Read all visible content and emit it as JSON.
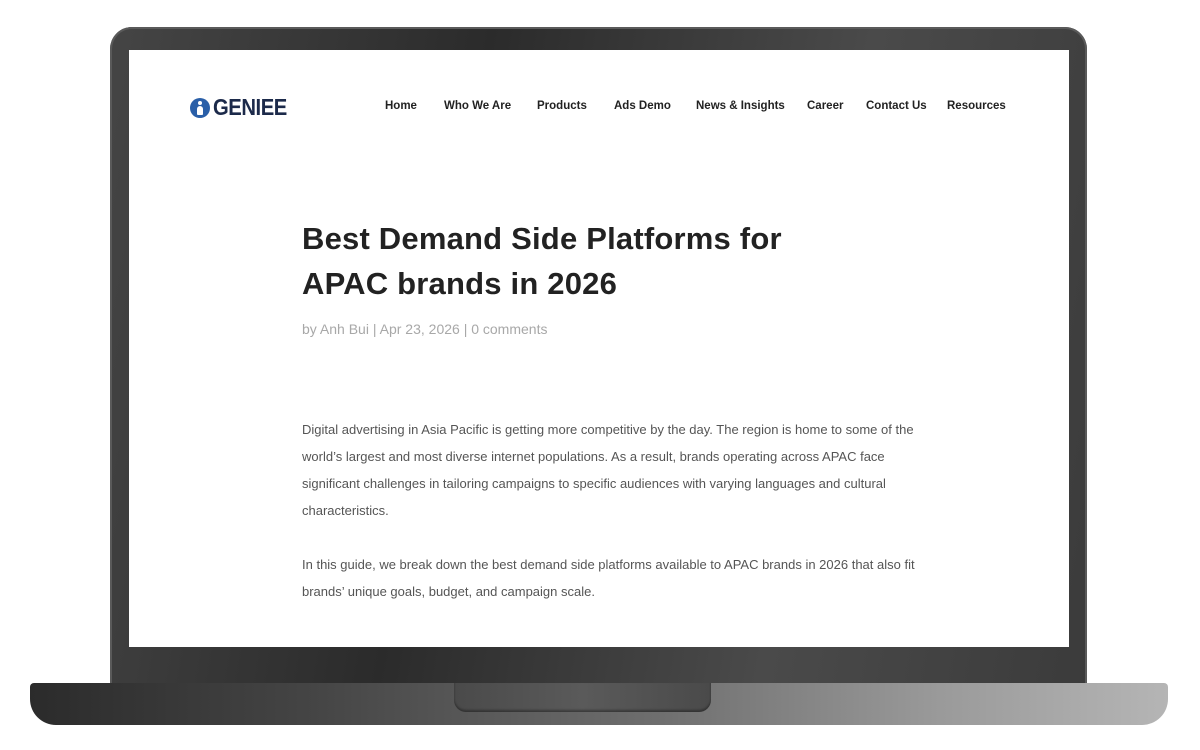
{
  "header": {
    "logo_text": "GENIEE",
    "brand_color": "#2a5fa8",
    "nav": [
      {
        "label": "Home"
      },
      {
        "label": "Who We Are"
      },
      {
        "label": "Products"
      },
      {
        "label": "Ads Demo"
      },
      {
        "label": "News & Insights"
      },
      {
        "label": "Career"
      },
      {
        "label": "Contact Us"
      },
      {
        "label": "Resources"
      }
    ]
  },
  "article": {
    "title_line1": "Best Demand Side Platforms for",
    "title_line2": "APAC brands in 2026",
    "meta": {
      "by": "by",
      "author": "Anh Bui",
      "sep1": "|",
      "date": "Apr 23, 2026",
      "sep2": "|",
      "comments": "0 comments"
    },
    "paragraphs": [
      "Digital advertising in Asia Pacific is getting more competitive by the day. The region is home to some of the world’s largest and most diverse internet populations. As a result, brands operating across APAC face significant challenges in tailoring campaigns to specific audiences with varying languages and cultural characteristics.",
      "In this guide, we break down the best demand side platforms available to APAC brands in 2026 that also fit brands’ unique goals, budget, and campaign scale."
    ]
  }
}
